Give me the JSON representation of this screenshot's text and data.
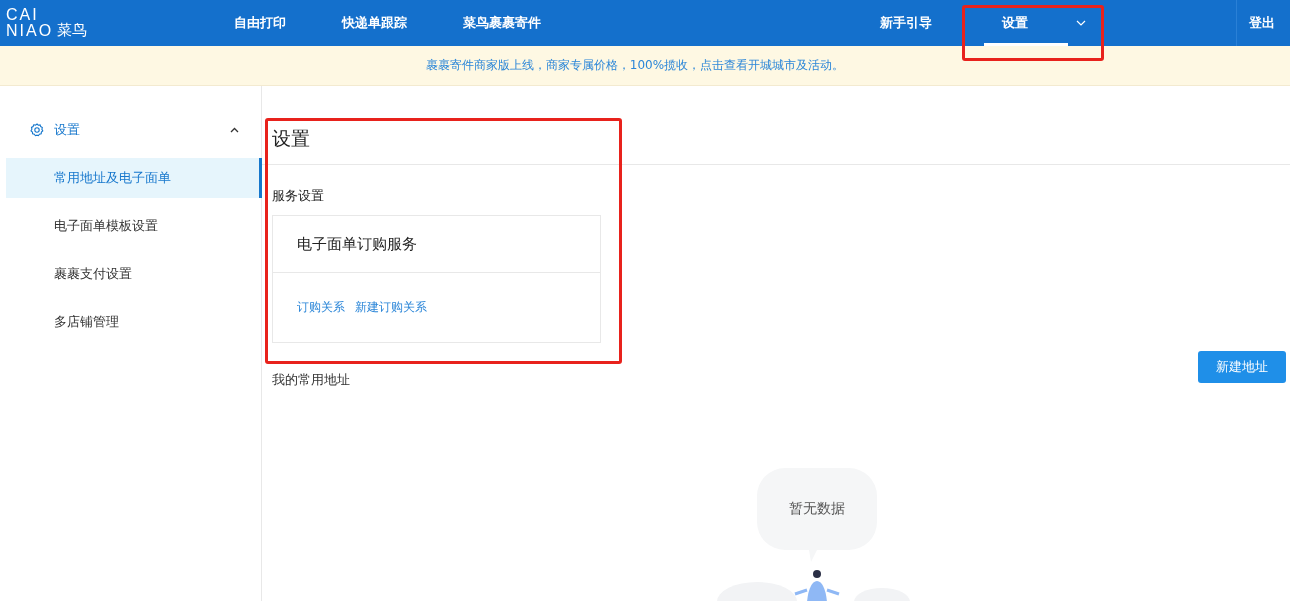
{
  "header": {
    "logo": {
      "latin_top": "CAI",
      "latin_bottom": "NIAO",
      "chinese": "菜鸟"
    },
    "nav_left": [
      {
        "label": "自由打印",
        "selected": false
      },
      {
        "label": "快递单跟踪",
        "selected": false
      },
      {
        "label": "菜鸟裹裹寄件",
        "selected": false
      }
    ],
    "nav_right": [
      {
        "label": "新手引导",
        "selected": false,
        "dropdown": false
      },
      {
        "label": "设置",
        "selected": true,
        "dropdown": true
      }
    ],
    "logout": "登出"
  },
  "banner": "裹裹寄件商家版上线，商家专属价格，100%揽收，点击查看开城城市及活动。",
  "sidebar": {
    "group": {
      "label": "设置",
      "expanded": true
    },
    "items": [
      {
        "label": "常用地址及电子面单",
        "selected": true
      },
      {
        "label": "电子面单模板设置",
        "selected": false
      },
      {
        "label": "裹裹支付设置",
        "selected": false
      },
      {
        "label": "多店铺管理",
        "selected": false
      }
    ]
  },
  "main": {
    "title": "设置",
    "section": "服务设置",
    "service_card": {
      "title": "电子面单订购服务",
      "links": [
        "订购关系",
        "新建订购关系"
      ]
    },
    "address_section": "我的常用地址",
    "new_address_button": "新建地址",
    "empty_text": "暂无数据"
  }
}
